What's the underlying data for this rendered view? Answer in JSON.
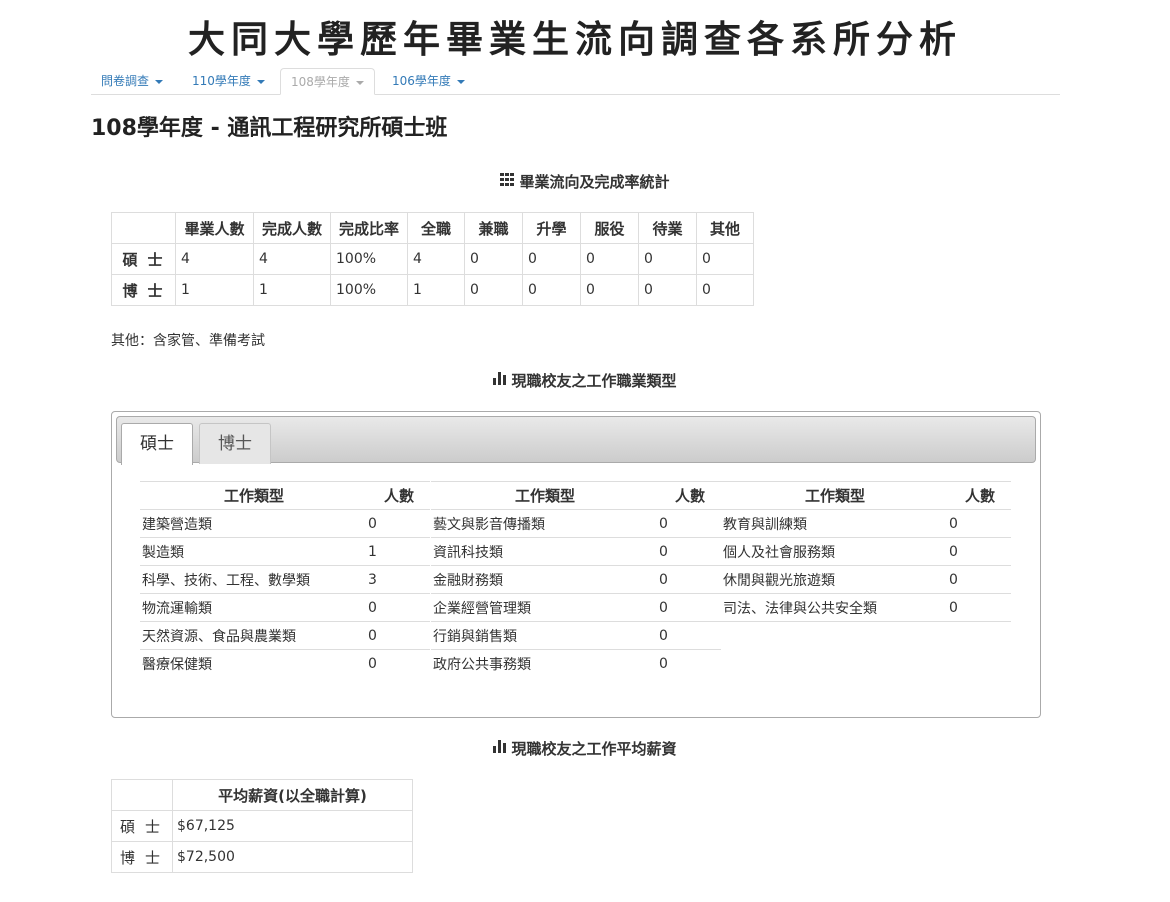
{
  "site": {
    "title": "大同大學歷年畢業生流向調查各系所分析"
  },
  "nav": {
    "tabs": [
      {
        "label": "問卷調查",
        "active": false
      },
      {
        "label": "110學年度",
        "active": false
      },
      {
        "label": "108學年度",
        "active": true
      },
      {
        "label": "106學年度",
        "active": false
      }
    ]
  },
  "department_title": "108學年度 - 通訊工程研究所碩士班",
  "graduation_stats": {
    "heading": "畢業流向及完成率統計",
    "icon": "grid-icon",
    "columns": [
      "",
      "畢業人數",
      "完成人數",
      "完成比率",
      "全職",
      "兼職",
      "升學",
      "服役",
      "待業",
      "其他"
    ],
    "rows": [
      {
        "label": "碩士",
        "values": [
          "4",
          "4",
          "100%",
          "4",
          "0",
          "0",
          "0",
          "0",
          "0"
        ]
      },
      {
        "label": "博士",
        "values": [
          "1",
          "1",
          "100%",
          "1",
          "0",
          "0",
          "0",
          "0",
          "0"
        ]
      }
    ],
    "note": "其他：含家管、準備考試"
  },
  "job_types": {
    "heading": "現職校友之工作職業類型",
    "icon": "bar-chart-icon",
    "tabs": [
      {
        "label": "碩士",
        "active": true
      },
      {
        "label": "博士",
        "active": false
      }
    ],
    "header_type": "工作類型",
    "header_count": "人數",
    "columns": [
      [
        {
          "type": "建築營造類",
          "count": "0"
        },
        {
          "type": "製造類",
          "count": "1"
        },
        {
          "type": "科學、技術、工程、數學類",
          "count": "3"
        },
        {
          "type": "物流運輸類",
          "count": "0"
        },
        {
          "type": "天然資源、食品與農業類",
          "count": "0"
        },
        {
          "type": "醫療保健類",
          "count": "0"
        }
      ],
      [
        {
          "type": "藝文與影音傳播類",
          "count": "0"
        },
        {
          "type": "資訊科技類",
          "count": "0"
        },
        {
          "type": "金融財務類",
          "count": "0"
        },
        {
          "type": "企業經營管理類",
          "count": "0"
        },
        {
          "type": "行銷與銷售類",
          "count": "0"
        },
        {
          "type": "政府公共事務類",
          "count": "0"
        }
      ],
      [
        {
          "type": "教育與訓練類",
          "count": "0"
        },
        {
          "type": "個人及社會服務類",
          "count": "0"
        },
        {
          "type": "休閒與觀光旅遊類",
          "count": "0"
        },
        {
          "type": "司法、法律與公共安全類",
          "count": "0"
        }
      ]
    ]
  },
  "salary": {
    "heading": "現職校友之工作平均薪資",
    "icon": "bar-chart-icon",
    "column_header": "平均薪資(以全職計算)",
    "rows": [
      {
        "label": "碩士",
        "value": "$67,125"
      },
      {
        "label": "博士",
        "value": "$72,500"
      }
    ]
  }
}
